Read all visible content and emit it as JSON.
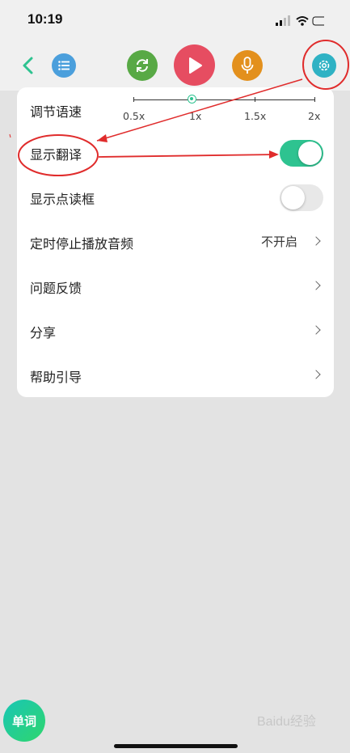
{
  "status": {
    "time": "10:19"
  },
  "toolbar": {
    "icons": [
      "back-icon",
      "list-icon",
      "repeat-icon",
      "play-icon",
      "mic-icon",
      "gear-icon"
    ],
    "colors": {
      "list": "#4b9fdc",
      "repeat": "#58a945",
      "play": "#e64d61",
      "mic": "#e3901d",
      "gear": "#2fb2c4",
      "accent": "#2ec390"
    }
  },
  "settings": {
    "speed": {
      "label": "调节语速",
      "ticks": [
        "0.5x",
        "1x",
        "1.5x",
        "2x"
      ],
      "selected": "1x"
    },
    "show_translation": {
      "label": "显示翻译",
      "on": true
    },
    "show_frame": {
      "label": "显示点读框",
      "on": false
    },
    "timer": {
      "label": "定时停止播放音频",
      "value": "不开启"
    },
    "feedback": {
      "label": "问题反馈"
    },
    "share": {
      "label": "分享"
    },
    "help": {
      "label": "帮助引导"
    }
  },
  "word_button": "单词",
  "watermark": "Baidu经验"
}
